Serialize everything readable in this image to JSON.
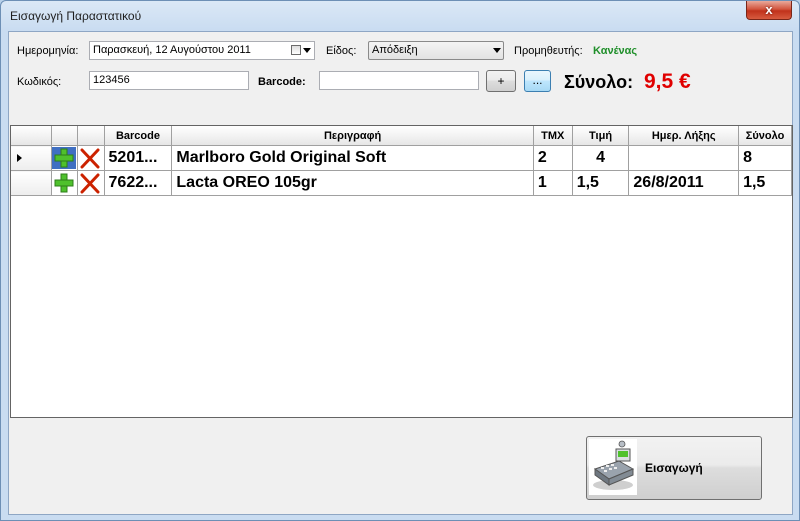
{
  "window": {
    "title": "Εισαγωγή Παραστατικού",
    "close_glyph": "x"
  },
  "form": {
    "date_label": "Ημερομηνία:",
    "date_value": "Παρασκευή, 12  Αυγούστου  2011",
    "type_label": "Είδος:",
    "type_value": "Απόδειξη",
    "supplier_label": "Προμηθευτής:",
    "supplier_value": "Κανένας",
    "code_label": "Κωδικός:",
    "code_value": "123456",
    "barcode_label": "Barcode:",
    "barcode_value": "",
    "plus_button": "+",
    "more_button": "...",
    "total_label": "Σύνολο:",
    "total_value": "9,5 €"
  },
  "grid": {
    "columns": [
      "Barcode",
      "Περιγραφή",
      "ΤΜΧ",
      "Τιμή",
      "Ημερ. Λήξης",
      "Σύνολο"
    ],
    "rows": [
      {
        "barcode": "5201...",
        "description": "Marlboro Gold Original Soft",
        "qty": "2",
        "price": "4",
        "expiry": "",
        "total": "8",
        "current": true
      },
      {
        "barcode": "7622...",
        "description": "Lacta OREO 105gr",
        "qty": "1",
        "price": "1,5",
        "expiry": "26/8/2011",
        "total": "1,5",
        "current": false
      }
    ]
  },
  "actions": {
    "import_label": "Εισαγωγή",
    "import_icon": "cash-register-icon"
  },
  "colors": {
    "total": "#e00000",
    "supplier": "#1f8f2a",
    "add_icon": "#3fae29",
    "delete_icon": "#cc2200"
  }
}
